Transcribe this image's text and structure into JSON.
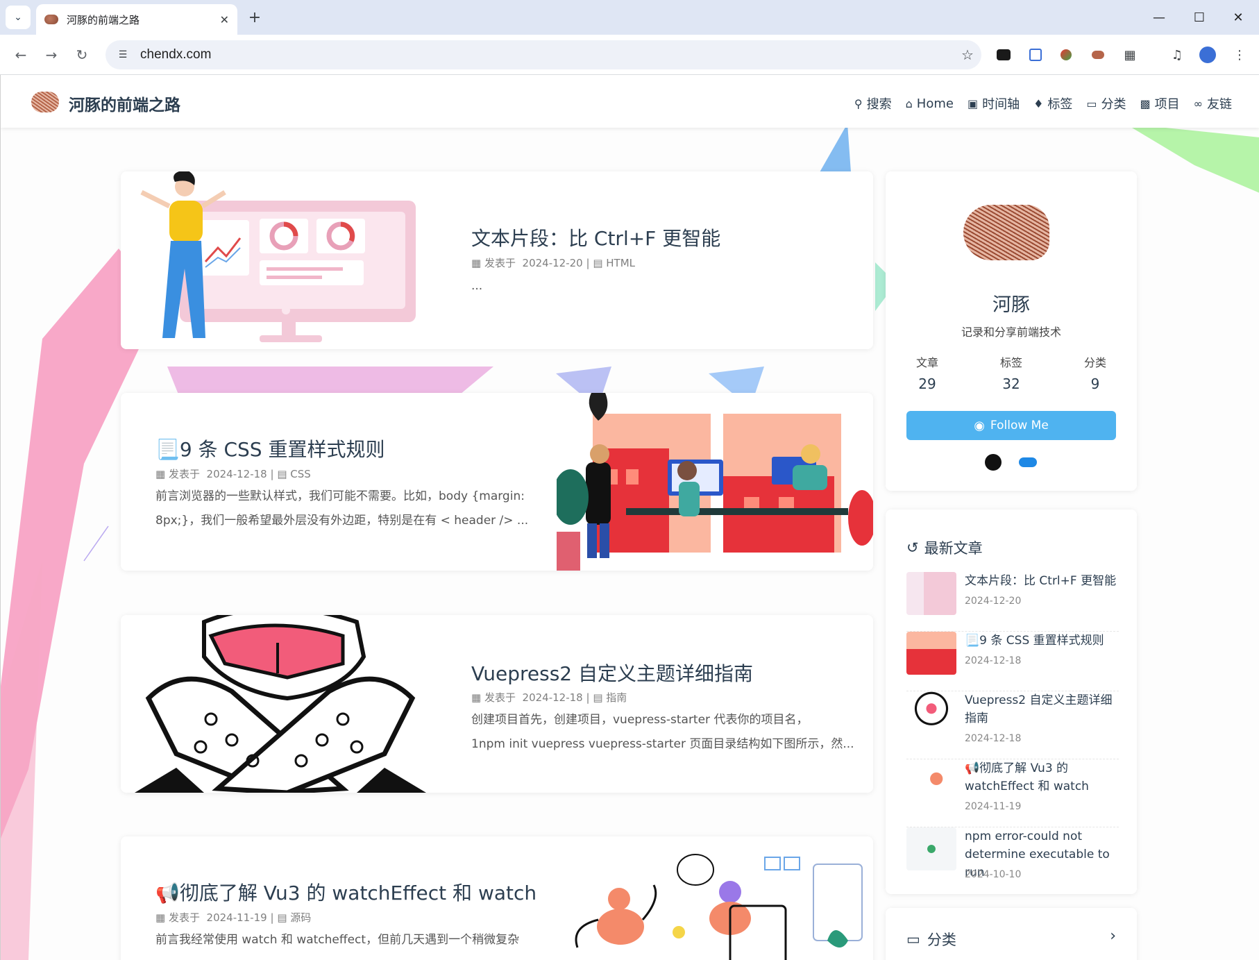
{
  "browser": {
    "tab_title": "河豚的前端之路",
    "url": "chendx.com",
    "new_tab": "+",
    "close": "✕"
  },
  "site": {
    "name": "河豚的前端之路",
    "nav": [
      {
        "label": "搜索",
        "icon": "search-icon"
      },
      {
        "label": "Home",
        "icon": "home-icon"
      },
      {
        "label": "时间轴",
        "icon": "archive-icon"
      },
      {
        "label": "标签",
        "icon": "tags-icon"
      },
      {
        "label": "分类",
        "icon": "folder-open-icon"
      },
      {
        "label": "项目",
        "icon": "file-icon"
      },
      {
        "label": "友链",
        "icon": "link-icon"
      }
    ]
  },
  "posts": [
    {
      "title": "文本片段：比 Ctrl+F 更智能",
      "meta_prefix": "发表于",
      "date": "2024-12-20",
      "category": "HTML",
      "excerpt": "..."
    },
    {
      "title": "📃9 条 CSS 重置样式规则",
      "meta_prefix": "发表于",
      "date": "2024-12-18",
      "category": "CSS",
      "excerpt_lines": [
        "前言浏览器的一些默认样式，我们可能不需要。比如，body {margin:",
        "8px;}，我们一般希望最外层没有外边距，特别是在有 < header /> ..."
      ]
    },
    {
      "title": "Vuepress2 自定义主题详细指南",
      "meta_prefix": "发表于",
      "date": "2024-12-18",
      "category": "指南",
      "excerpt_lines": [
        "创建项目首先，创建项目，vuepress-starter 代表你的项目名，",
        "1npm init vuepress vuepress-starter 页面目录结构如下图所示，然..."
      ]
    },
    {
      "title": "📢彻底了解 Vu3 的 watchEffect 和 watch",
      "meta_prefix": "发表于",
      "date": "2024-11-19",
      "category": "源码",
      "excerpt_lines": [
        "前言我经常使用 watch 和 watcheffect，但前几天遇到一个稍微复杂"
      ]
    }
  ],
  "profile": {
    "name": "河豚",
    "description": "记录和分享前端技术",
    "stats": [
      {
        "label": "文章",
        "value": "29"
      },
      {
        "label": "标签",
        "value": "32"
      },
      {
        "label": "分类",
        "value": "9"
      }
    ],
    "follow_label": "Follow Me",
    "follow_color": "#4fb3f0"
  },
  "recent": {
    "heading": "最新文章",
    "items": [
      {
        "title": "文本片段：比 Ctrl+F 更智能",
        "date": "2024-12-20"
      },
      {
        "title": "📃9 条 CSS 重置样式规则",
        "date": "2024-12-18"
      },
      {
        "title": "Vuepress2 自定义主题详细指南",
        "date": "2024-12-18"
      },
      {
        "title": "📢彻底了解 Vu3 的 watchEffect 和 watch",
        "date": "2024-11-19"
      },
      {
        "title": "npm error-could not determine executable to run",
        "date": "2024-10-10"
      }
    ]
  },
  "categories_heading": "分类"
}
